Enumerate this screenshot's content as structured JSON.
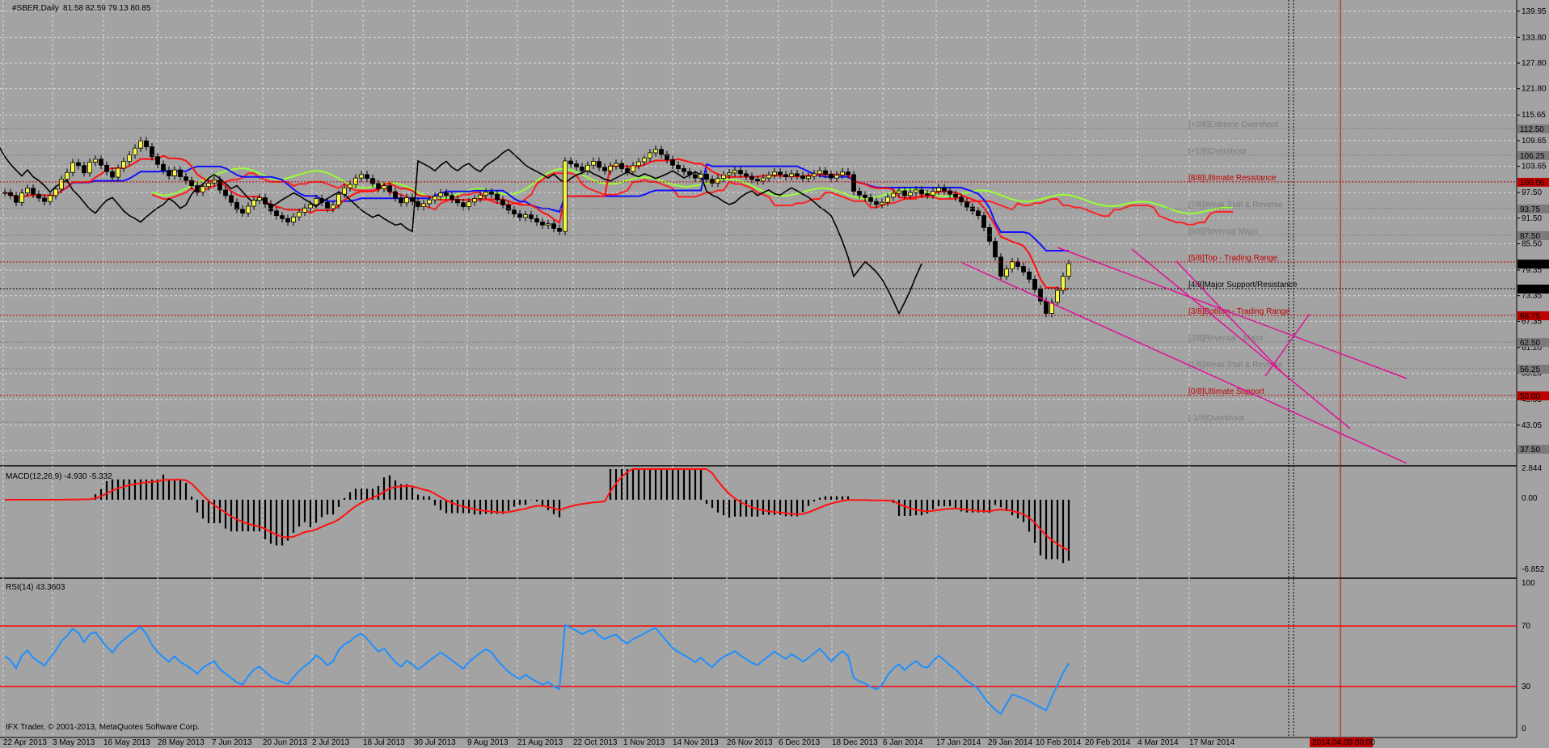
{
  "chart_data": {
    "type": "candlestick",
    "title": "#SBER,Daily",
    "ohlc_text": "81.58 82.59 79.13 80.85",
    "price_ticks": [
      "139.95",
      "133.80",
      "127.80",
      "121.80",
      "115.65",
      "109.65",
      "103.65",
      "97.50",
      "91.50",
      "85.50",
      "79.35",
      "73.35",
      "67.35",
      "61.20",
      "55.20",
      "49.05",
      "43.05",
      "37.05"
    ],
    "price_range": [
      34.3,
      142.0
    ],
    "marked_prices": [
      {
        "text": "112.50",
        "value": 112.5,
        "color": "#7b7b7b"
      },
      {
        "text": "106.25",
        "value": 106.25,
        "color": "#7b7b7b"
      },
      {
        "text": "100.00",
        "value": 100.0,
        "color": "#c00000"
      },
      {
        "text": "93.75",
        "value": 93.75,
        "color": "#7b7b7b"
      },
      {
        "text": "87.50",
        "value": 87.5,
        "color": "#7b7b7b"
      },
      {
        "text": "80.85",
        "value": 80.85,
        "color": "#000000"
      },
      {
        "text": "75.00",
        "value": 75.0,
        "color": "#000000"
      },
      {
        "text": "68.75",
        "value": 68.75,
        "color": "#c00000"
      },
      {
        "text": "62.50",
        "value": 62.5,
        "color": "#7b7b7b"
      },
      {
        "text": "56.25",
        "value": 56.25,
        "color": "#7b7b7b"
      },
      {
        "text": "50.00",
        "value": 50.0,
        "color": "#c00000"
      },
      {
        "text": "37.50",
        "value": 37.5,
        "color": "#7b7b7b"
      }
    ],
    "murrey_levels": [
      {
        "text": "[+2/8]Extreme Overshoot",
        "value": 112.5,
        "color": "#7b7b7b"
      },
      {
        "text": "[+1/8]Overshoot",
        "value": 106.25,
        "color": "#7b7b7b"
      },
      {
        "text": "[8/8]Ultimate Resistance",
        "value": 100.0,
        "color": "#c00000"
      },
      {
        "text": "[7/8]Weak Stall & Reverse",
        "value": 93.75,
        "color": "#7b7b7b"
      },
      {
        "text": "[6/8]Reversal Major",
        "value": 87.5,
        "color": "#7b7b7b"
      },
      {
        "text": "[5/8]Top - Trading Range",
        "value": 81.25,
        "color": "#c00000"
      },
      {
        "text": "[4/8]Major Support/Resistance",
        "value": 75.0,
        "color": "#000000"
      },
      {
        "text": "[3/8]Bottom - Trading Range",
        "value": 68.75,
        "color": "#c00000"
      },
      {
        "text": "[2/8]Reversal - Major",
        "value": 62.5,
        "color": "#7b7b7b"
      },
      {
        "text": "[1/8]Weak Stall & Reverse",
        "value": 56.25,
        "color": "#7b7b7b"
      },
      {
        "text": "[0/8]Ultimate Support",
        "value": 50.0,
        "color": "#c00000"
      },
      {
        "text": "[-1/8]Overshoot",
        "value": 43.75,
        "color": "#7b7b7b"
      }
    ],
    "date_labels": [
      "22 Apr 2013",
      "3 May 2013",
      "16 May 2013",
      "28 May 2013",
      "7 Jun 2013",
      "20 Jun 2013",
      "2 Jul 2013",
      "18 Jul 2013",
      "30 Jul 2013",
      "9 Aug 2013",
      "21 Aug 2013",
      "22 Oct 2013",
      "1 Nov 2013",
      "14 Nov 2013",
      "26 Nov 2013",
      "6 Dec 2013",
      "18 Dec 2013",
      "6 Jan 2014",
      "17 Jan 2014",
      "29 Jan 2014",
      "10 Feb 2014",
      "20 Feb 2014",
      "4 Mar 2014",
      "17 Mar 2014"
    ],
    "cursor_date": "2014.04.09 00:00",
    "close": [
      97.5,
      96.8,
      95.2,
      97.4,
      98.5,
      97.1,
      96.2,
      95.4,
      96.8,
      98.3,
      100.6,
      102.2,
      104.5,
      103.8,
      102.1,
      104.6,
      105.3,
      103.9,
      102.4,
      101.1,
      103.2,
      104.8,
      106.3,
      107.9,
      109.6,
      108.2,
      105.9,
      104.1,
      102.7,
      101.4,
      102.8,
      101.2,
      100.3,
      99.1,
      97.6,
      98.9,
      99.7,
      100.4,
      98.1,
      96.8,
      95.2,
      93.6,
      92.7,
      94.3,
      95.7,
      96.3,
      94.8,
      93.2,
      92.1,
      91.4,
      90.6,
      91.8,
      92.9,
      93.9,
      94.7,
      96.1,
      95.2,
      93.8,
      94.6,
      97.1,
      98.6,
      99.4,
      100.9,
      101.7,
      100.8,
      99.6,
      98.4,
      99.1,
      97.7,
      96.2,
      95.1,
      96.3,
      95.4,
      94.2,
      94.9,
      95.8,
      96.6,
      97.4,
      96.8,
      95.9,
      95.1,
      94.2,
      95.3,
      96.1,
      96.9,
      97.6,
      97.1,
      95.8,
      94.6,
      93.4,
      92.5,
      91.7,
      92.3,
      91.4,
      90.6,
      89.9,
      90.2,
      89.1,
      88.4,
      104.9,
      104.2,
      103.5,
      102.6,
      103.9,
      104.8,
      103.4,
      102.6,
      103.7,
      104.3,
      103.1,
      102.4,
      103.8,
      104.7,
      105.6,
      106.8,
      107.6,
      106.4,
      105.2,
      103.9,
      103.1,
      102.4,
      101.7,
      100.9,
      101.8,
      100.6,
      99.7,
      100.8,
      101.6,
      102.1,
      102.7,
      101.9,
      101.3,
      100.6,
      100.2,
      100.9,
      101.6,
      102.3,
      101.7,
      101.2,
      101.9,
      101.4,
      100.8,
      101.3,
      101.9,
      102.6,
      101.8,
      100.9,
      101.6,
      102.3,
      101.7,
      97.8,
      96.9,
      96.3,
      95.4,
      94.7,
      95.2,
      96.4,
      97.3,
      97.9,
      96.8,
      97.5,
      98.1,
      97.2,
      96.9,
      97.8,
      98.6,
      97.9,
      97.1,
      96.4,
      95.3,
      94.1,
      93.2,
      92.1,
      89.3,
      86.1,
      82.4,
      77.9,
      79.6,
      81.3,
      80.2,
      78.9,
      77.2,
      74.8,
      72.1,
      69.2,
      71.8,
      74.6,
      77.9,
      80.85
    ],
    "cloud_span_a": [
      97.6,
      97.2,
      96.8,
      96.9,
      97.3,
      97.8,
      98.4,
      99.1,
      99.8,
      100.4,
      101.0,
      101.6,
      102.1,
      102.5,
      102.8,
      103.1,
      103.2,
      103.0,
      102.6,
      102.0,
      101.4,
      100.9,
      100.6,
      100.6,
      100.9,
      101.3,
      101.7,
      102.1,
      102.4,
      102.6,
      102.5,
      102.1,
      101.5,
      100.8,
      100.1,
      99.4,
      98.9,
      98.6,
      98.6,
      98.9,
      99.3,
      99.6,
      99.8,
      99.7,
      99.4,
      98.9,
      98.3,
      97.6,
      96.9,
      96.4,
      96.1,
      96.0,
      96.2,
      96.6,
      97.1,
      97.6,
      98.0,
      98.3,
      98.4,
      98.2,
      97.9,
      97.5,
      97.2,
      97.1,
      97.2,
      97.6,
      98.3,
      99.2,
      100.2,
      101.2,
      102.1,
      102.7,
      103.0,
      103.0,
      102.8,
      102.3,
      101.7,
      101.0,
      100.4,
      99.9,
      99.6,
      99.5,
      99.6,
      99.9,
      100.3,
      100.7,
      101.0,
      101.1,
      101.0,
      100.7,
      100.3,
      99.8,
      99.4,
      99.1,
      98.9,
      98.9,
      99.1,
      99.4,
      99.7,
      100.1,
      100.4,
      100.6,
      100.6,
      100.5,
      100.2,
      99.7,
      99.1,
      98.4,
      97.8,
      97.3,
      96.9,
      96.7,
      96.7,
      96.9,
      97.2,
      97.6,
      98.0,
      98.3,
      98.5,
      98.5,
      98.3,
      97.9,
      97.4,
      96.9,
      96.5,
      96.2,
      96.1,
      96.2,
      96.4,
      96.8,
      97.2,
      97.6,
      98.0,
      98.2,
      98.3,
      98.2,
      97.9,
      97.5,
      97.1,
      96.8,
      96.6,
      96.6,
      96.8,
      97.1,
      97.5,
      97.8,
      98.0,
      98.0,
      97.8,
      97.4,
      96.9,
      96.4,
      95.9,
      95.6,
      95.4,
      95.4,
      95.6,
      95.9,
      96.3,
      96.6,
      96.9,
      97.0,
      96.9,
      96.6,
      96.2,
      95.7,
      95.2,
      94.8,
      94.5,
      94.3,
      94.3,
      94.5,
      94.8,
      95.1,
      95.3,
      95.4,
      95.3,
      95.0,
      94.6,
      94.1,
      93.6,
      93.1,
      92.8,
      92.6,
      92.6,
      92.8,
      93.1,
      93.4,
      93.7,
      93.9,
      94.0,
      94.0
    ]
  }
}
